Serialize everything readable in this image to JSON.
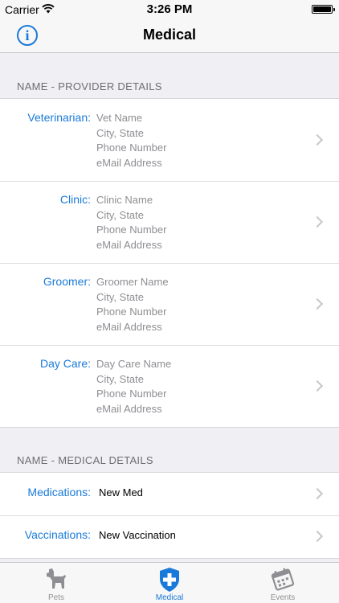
{
  "status_bar": {
    "carrier": "Carrier",
    "time": "3:26 PM"
  },
  "nav": {
    "title": "Medical",
    "info_icon": "info-icon"
  },
  "sections": {
    "provider_header": "NAME - PROVIDER DETAILS",
    "medical_header": "NAME - MEDICAL DETAILS"
  },
  "providers": [
    {
      "label": "Veterinarian:",
      "name": "Vet Name",
      "city": "City, State",
      "phone": "Phone Number",
      "email": "eMail Address"
    },
    {
      "label": "Clinic:",
      "name": "Clinic Name",
      "city": "City, State",
      "phone": "Phone Number",
      "email": "eMail Address"
    },
    {
      "label": "Groomer:",
      "name": "Groomer Name",
      "city": "City, State",
      "phone": "Phone Number",
      "email": "eMail Address"
    },
    {
      "label": "Day Care:",
      "name": "Day Care Name",
      "city": "City, State",
      "phone": "Phone Number",
      "email": "eMail Address"
    }
  ],
  "medical": [
    {
      "label": "Medications:",
      "value": "New Med"
    },
    {
      "label": "Vaccinations:",
      "value": "New Vaccination"
    }
  ],
  "tabs": [
    {
      "label": "Pets",
      "icon": "dog-icon"
    },
    {
      "label": "Medical",
      "icon": "medical-shield-icon"
    },
    {
      "label": "Events",
      "icon": "calendar-icon"
    }
  ],
  "colors": {
    "accent": "#1a7ad9",
    "secondary_text": "#8e8e93",
    "background": "#efeff4"
  }
}
